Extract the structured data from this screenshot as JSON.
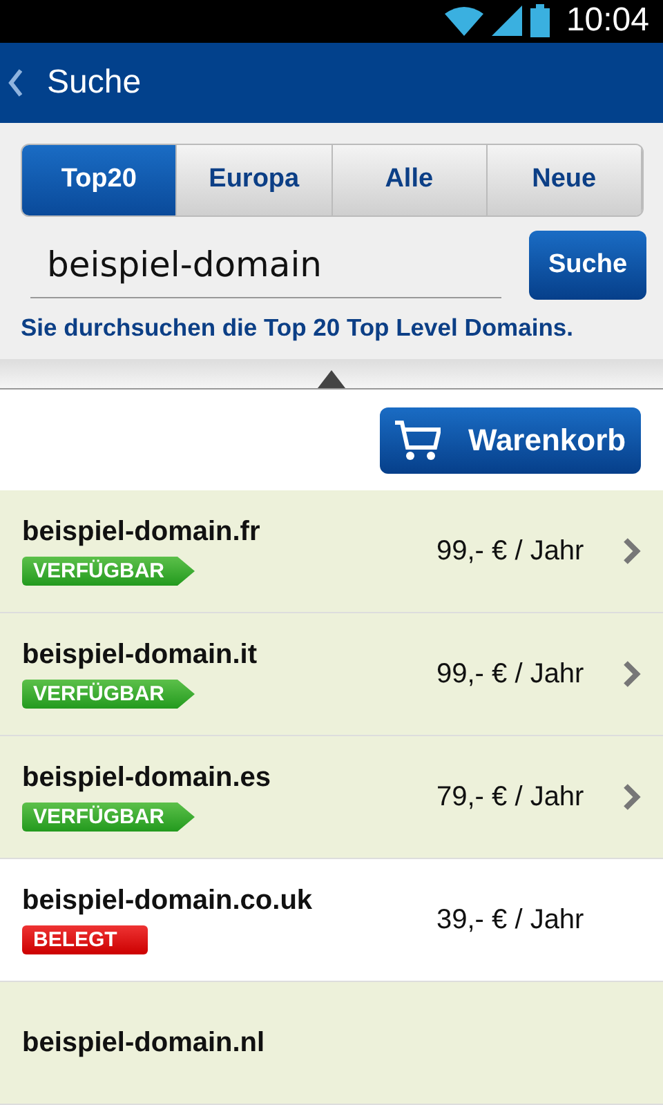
{
  "status_bar": {
    "time": "10:04"
  },
  "app_bar": {
    "title": "Suche"
  },
  "tabs": [
    {
      "label": "Top20",
      "selected": true
    },
    {
      "label": "Europa",
      "selected": false
    },
    {
      "label": "Alle",
      "selected": false
    },
    {
      "label": "Neue",
      "selected": false
    }
  ],
  "search": {
    "value": "beispiel-domain",
    "button": "Suche",
    "hint": "Sie durchsuchen die Top 20 Top Level Domains."
  },
  "cart_button": "Warenkorb",
  "results": [
    {
      "kind": "available",
      "domain": "beispiel-domain.fr",
      "badge": "VERFÜGBAR",
      "price": "99,- € / Jahr"
    },
    {
      "kind": "available",
      "domain": "beispiel-domain.it",
      "badge": "VERFÜGBAR",
      "price": "99,- € / Jahr"
    },
    {
      "kind": "available",
      "domain": "beispiel-domain.es",
      "badge": "VERFÜGBAR",
      "price": "79,- € / Jahr"
    },
    {
      "kind": "taken",
      "domain": "beispiel-domain.co.uk",
      "badge": "BELEGT",
      "price": "39,- € / Jahr"
    },
    {
      "kind": "available",
      "domain": "beispiel-domain.nl"
    }
  ]
}
